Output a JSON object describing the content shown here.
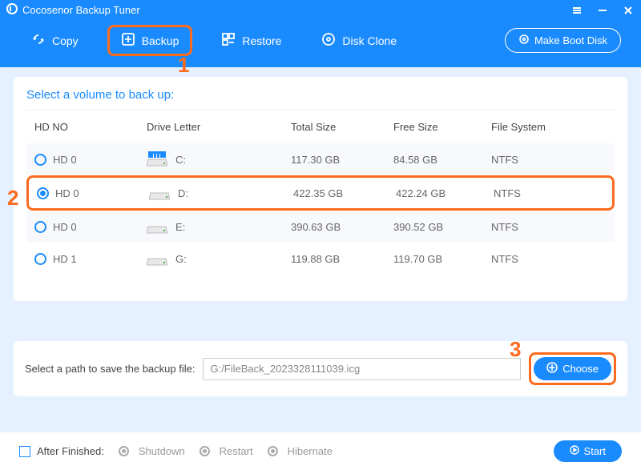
{
  "app": {
    "title": "Cocosenor Backup Tuner"
  },
  "toolbar": {
    "copy": "Copy",
    "backup": "Backup",
    "restore": "Restore",
    "diskclone": "Disk Clone",
    "bootdisk": "Make Boot Disk"
  },
  "section": {
    "select_volume": "Select a volume to back up:"
  },
  "columns": {
    "hdno": "HD NO",
    "drive": "Drive Letter",
    "total": "Total Size",
    "free": "Free Size",
    "fs": "File System"
  },
  "rows": [
    {
      "hd": "HD 0",
      "letter": "C:",
      "total": "117.30 GB",
      "free": "84.58 GB",
      "fs": "NTFS",
      "selected": false,
      "os": true
    },
    {
      "hd": "HD 0",
      "letter": "D:",
      "total": "422.35 GB",
      "free": "422.24 GB",
      "fs": "NTFS",
      "selected": true,
      "os": false
    },
    {
      "hd": "HD 0",
      "letter": "E:",
      "total": "390.63 GB",
      "free": "390.52 GB",
      "fs": "NTFS",
      "selected": false,
      "os": false
    },
    {
      "hd": "HD 1",
      "letter": "G:",
      "total": "119.88 GB",
      "free": "119.70 GB",
      "fs": "NTFS",
      "selected": false,
      "os": false
    }
  ],
  "path": {
    "label": "Select a path to save the backup file:",
    "value": "G:/FileBack_2023328111039.icg",
    "choose": "Choose"
  },
  "footer": {
    "after": "After Finished:",
    "shutdown": "Shutdown",
    "restart": "Restart",
    "hibernate": "Hibernate",
    "start": "Start"
  },
  "annotations": {
    "1": "1",
    "2": "2",
    "3": "3"
  }
}
